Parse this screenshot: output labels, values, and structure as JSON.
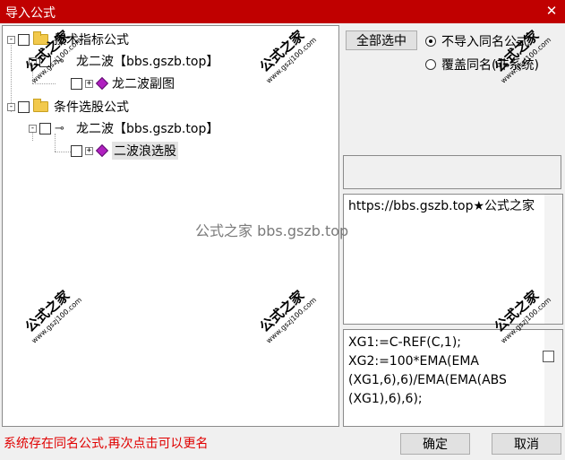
{
  "window": {
    "title": "导入公式",
    "close_glyph": "✕"
  },
  "tree": [
    {
      "label": "技术指标公式",
      "toggle": "-",
      "kind": "folder"
    },
    {
      "label": "龙二波【bbs.gszb.top】",
      "toggle": "-",
      "kind": "key"
    },
    {
      "label": "龙二波副图",
      "toggle": "+",
      "kind": "gem"
    },
    {
      "label": "条件选股公式",
      "toggle": "-",
      "kind": "folder"
    },
    {
      "label": "龙二波【bbs.gszb.top】",
      "toggle": "-",
      "kind": "key"
    },
    {
      "label": "二波浪选股",
      "toggle": "+",
      "kind": "gem",
      "selected": true
    }
  ],
  "options": {
    "select_all_label": "全部选中",
    "radio_skip_label": "不导入同名公式",
    "radio_overwrite_label": "覆盖同名(非系统)",
    "selected": "skip"
  },
  "description_text": "https://bbs.gszb.top★公式之家",
  "formula_text": "XG1:=C-REF(C,1);\nXG2:=100*EMA(EMA\n(XG1,6),6)/EMA(EMA(ABS\n(XG1),6),6);",
  "status_text": "系统存在同名公式,再次点击可以更名",
  "buttons": {
    "ok_label": "确定",
    "cancel_label": "取消"
  },
  "watermark": {
    "center_text": "公式之家 bbs.gszb.top",
    "stamp_title": "公式之家",
    "stamp_url": "www.gszj100.com"
  }
}
